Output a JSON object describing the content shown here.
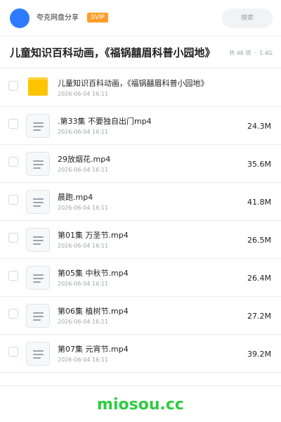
{
  "header": {
    "owner_name": "夸克网盘分享",
    "badge": "SVIP",
    "search_placeholder": "搜索"
  },
  "share": {
    "title": "儿童知识百科动画，《福锅囍眉科普小园地》",
    "count": "共 46 项",
    "separator": "·",
    "total_size": "1.4G"
  },
  "items": [
    {
      "type": "folder",
      "name": "儿童知识百科动画，《福锅囍眉科普小园地》",
      "date": "2026-06-04 16:11",
      "size": ""
    },
    {
      "type": "file",
      "name": ".第33集  不要独自出门mp4",
      "date": "2026-06-04 16:11",
      "size": "24.3M"
    },
    {
      "type": "file",
      "name": "29放烟花.mp4",
      "date": "2026-06-04 16:11",
      "size": "35.6M"
    },
    {
      "type": "file",
      "name": "晨跑.mp4",
      "date": "2026-06-04 16:11",
      "size": "41.8M"
    },
    {
      "type": "file",
      "name": "第01集  万圣节.mp4",
      "date": "2026-06-04 16:11",
      "size": "26.5M"
    },
    {
      "type": "file",
      "name": "第05集  中秋节.mp4",
      "date": "2026-06-04 16:11",
      "size": "26.4M"
    },
    {
      "type": "file",
      "name": "第06集  植树节.mp4",
      "date": "2026-06-04 16:11",
      "size": "27.2M"
    },
    {
      "type": "file",
      "name": "第07集  元宵节.mp4",
      "date": "2026-06-04 16:11",
      "size": "39.2M"
    }
  ],
  "footer": {
    "watermark": "miosou.cc"
  },
  "colors": {
    "avatar": "#2f7bff",
    "badge": "#ff9d2a",
    "folder": "#ffc400",
    "watermark": "#2ecc40"
  },
  "icons": {
    "folder": "folder-icon",
    "file": "file-icon"
  }
}
